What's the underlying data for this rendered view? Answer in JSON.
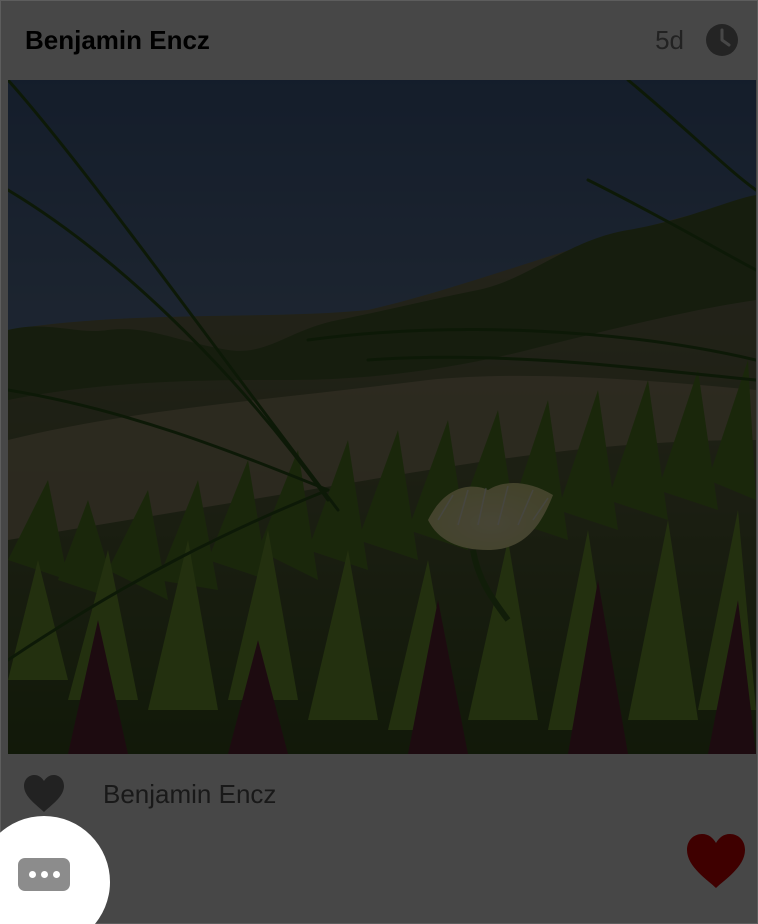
{
  "post": {
    "author": "Benjamin Encz",
    "timestamp": "5d",
    "icons": {
      "timestamp": "clock-icon",
      "likes": "heart-icon",
      "like_button": "heart-icon",
      "more": "more-dots-icon"
    },
    "likes": {
      "liked_by": "Benjamin Encz"
    },
    "liked": true
  },
  "overlay": {
    "highlighted_control": "more-button"
  },
  "colors": {
    "like_active": "#e00000",
    "muted_text": "#7a7a7a",
    "more_button_bg": "#8c8c8c"
  }
}
